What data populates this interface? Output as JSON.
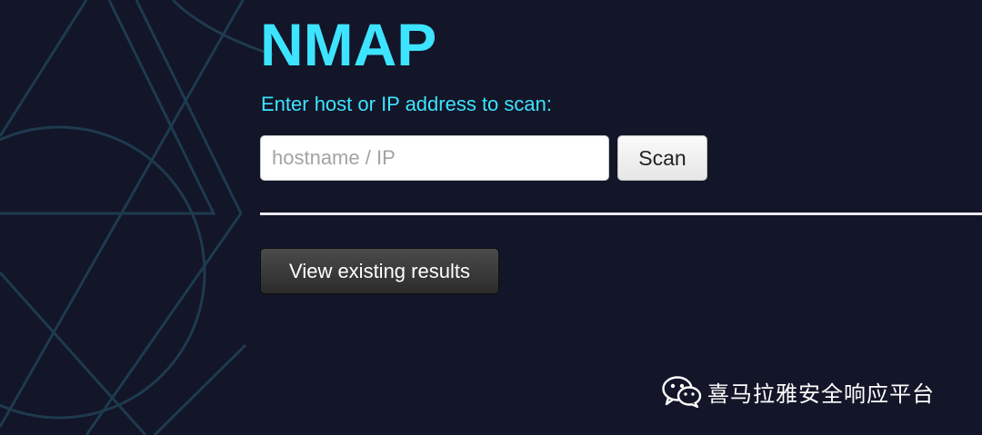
{
  "theme": {
    "background": "#131528",
    "accent": "#3de4ff",
    "line_art": "#1e3a4f"
  },
  "header": {
    "title": "NMAP"
  },
  "scan_form": {
    "prompt": "Enter host or IP address to scan:",
    "input_value": "",
    "input_placeholder": "hostname / IP",
    "scan_button_label": "Scan"
  },
  "results": {
    "view_button_label": "View existing results"
  },
  "watermark": {
    "icon": "wechat-icon",
    "text": "喜马拉雅安全响应平台"
  }
}
